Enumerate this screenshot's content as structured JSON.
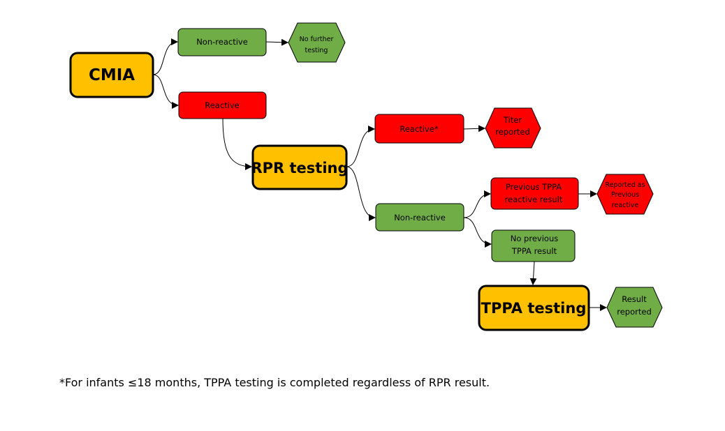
{
  "colors": {
    "orange": "#FFC000",
    "green": "#70AD47",
    "red": "#FF0000"
  },
  "nodes": {
    "cmia": "CMIA",
    "cmia_nonreactive": "Non-reactive",
    "no_further_testing": [
      "No further",
      "testing"
    ],
    "cmia_reactive": "Reactive",
    "rpr": "RPR testing",
    "rpr_reactive": "Reactive*",
    "titer_reported": [
      "Titer",
      "reported"
    ],
    "rpr_nonreactive": "Non-reactive",
    "prev_tppa_reactive": [
      "Previous TPPA",
      "reactive result"
    ],
    "reported_prev_reactive": [
      "Reported as",
      "Previous",
      "reactive"
    ],
    "no_prev_tppa": [
      "No previous",
      "TPPA result"
    ],
    "tppa": "TPPA testing",
    "result_reported": [
      "Result",
      "reported"
    ]
  },
  "footnote": "*For infants ≤18 months, TPPA testing is completed regardless of RPR result."
}
